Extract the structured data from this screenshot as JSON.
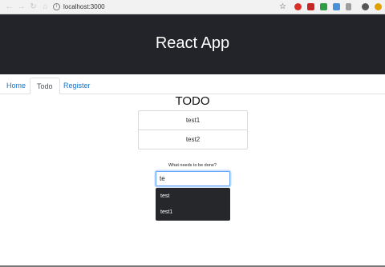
{
  "browser": {
    "back_icon": "arrow-left-icon",
    "forward_icon": "arrow-right-icon",
    "reload_icon": "reload-icon",
    "home_icon": "home-icon",
    "url": "localhost:3000",
    "extension_colors": [
      "#d93025",
      "#c62828",
      "#2e9e44",
      "#4a90d9",
      "#9e9e9e",
      "#555555",
      "#e0a000"
    ]
  },
  "header": {
    "title": "React App"
  },
  "tabs": [
    {
      "label": "Home",
      "active": false
    },
    {
      "label": "Todo",
      "active": true
    },
    {
      "label": "Register",
      "active": false
    }
  ],
  "todo": {
    "heading": "TODO",
    "items": [
      "test1",
      "test2"
    ],
    "input_label": "What needs to be done?",
    "input_value": "te",
    "suggestions": [
      "test",
      "test1"
    ]
  }
}
